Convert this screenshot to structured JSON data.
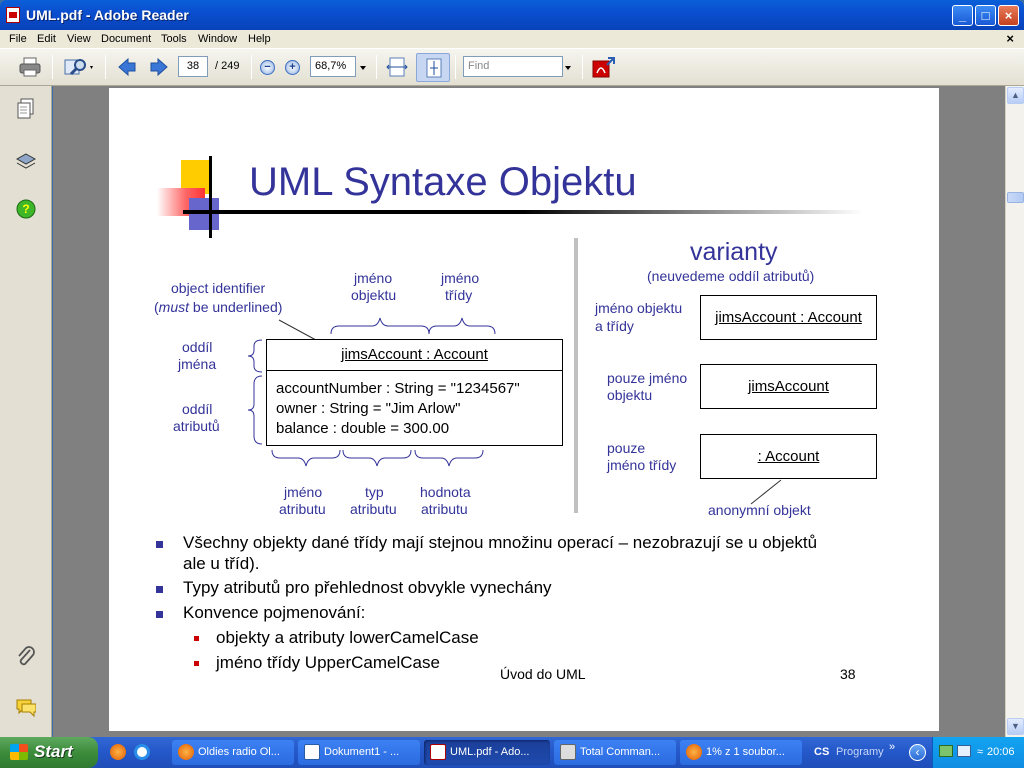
{
  "window": {
    "title": "UML.pdf - Adobe Reader"
  },
  "menu": [
    "File",
    "Edit",
    "View",
    "Document",
    "Tools",
    "Window",
    "Help"
  ],
  "toolbar": {
    "page_current": "38",
    "page_total": "/ 249",
    "zoom": "68,7%",
    "find_placeholder": "Find"
  },
  "slide": {
    "title": "UML Syntaxe Objektu",
    "left": {
      "object_identifier": "object identifier",
      "must_word": "must",
      "must_rest": " be underlined)",
      "must_prefix": "(",
      "jmeno_objektu_1": "jméno",
      "jmeno_objektu_2": "objektu",
      "jmeno_tridy_1": "jméno",
      "jmeno_tridy_2": "třídy",
      "oddil_jmena_1": "oddíl",
      "oddil_jmena_2": "jména",
      "oddil_atributu_1": "oddíl",
      "oddil_atributu_2": "atributů",
      "object_name": "jimsAccount : Account",
      "attr1": "accountNumber : String = \"1234567\"",
      "attr2": "owner : String = \"Jim Arlow\"",
      "attr3": "balance : double = 300.00",
      "jmeno_atributu_1": "jméno",
      "jmeno_atributu_2": "atributu",
      "typ_atributu_1": "typ",
      "typ_atributu_2": "atributu",
      "hodnota_atributu_1": "hodnota",
      "hodnota_atributu_2": "atributu"
    },
    "right": {
      "heading": "varianty",
      "subheading": "(neuvedeme oddíl atributů)",
      "v1_label_1": "jméno objektu",
      "v1_label_2": "a třídy",
      "v1_box": "jimsAccount : Account",
      "v2_label_1": "pouze jméno",
      "v2_label_2": "objektu",
      "v2_box": "jimsAccount",
      "v3_label_1": "pouze",
      "v3_label_2": "jméno třídy",
      "v3_box": ": Account",
      "anon": "anonymní objekt"
    },
    "bullets": [
      "Všechny objekty dané třídy mají stejnou množinu operací – nezobrazují se u objektů",
      "ale u tříd).",
      "Typy atributů pro přehlednost obvykle vynechány",
      "Konvence pojmenování:"
    ],
    "subbullets": [
      "objekty a atributy lowerCamelCase",
      "jméno třídy UpperCamelCase"
    ],
    "footer": "Úvod do UML",
    "page_number": "38"
  },
  "taskbar": {
    "start": "Start",
    "tasks": [
      "Oldies radio Ol...",
      "Dokument1 - ...",
      "UML.pdf - Ado...",
      "Total Comman...",
      "1% z 1 soubor..."
    ],
    "lang": "CS",
    "programy": "Programy",
    "clock": "20:06"
  },
  "colors": {
    "slide_blue": "#333399",
    "title_blue": "#333399"
  }
}
